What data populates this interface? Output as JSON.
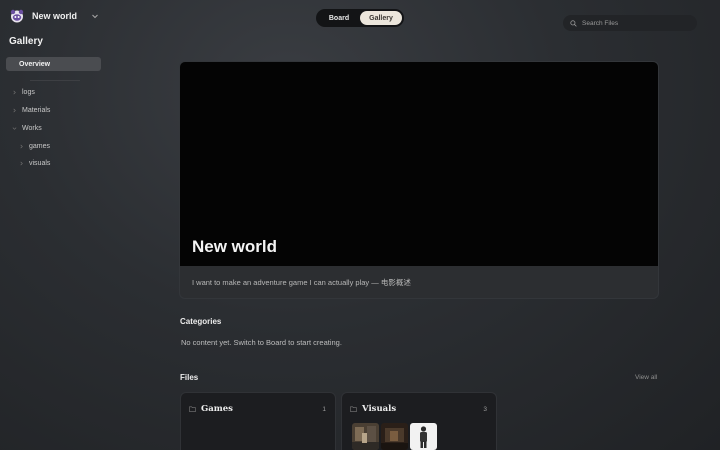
{
  "header": {
    "workspace_name": "New world",
    "view_tabs": [
      {
        "label": "Board",
        "active": false
      },
      {
        "label": "Gallery",
        "active": true
      }
    ],
    "search": {
      "placeholder": "Search Files"
    }
  },
  "sidebar": {
    "title": "Gallery",
    "overview_label": "Overview",
    "tree": [
      {
        "label": "logs",
        "depth": 0
      },
      {
        "label": "Materials",
        "depth": 0
      },
      {
        "label": "Works",
        "depth": 0,
        "expanded": true
      },
      {
        "label": "games",
        "depth": 1
      },
      {
        "label": "visuals",
        "depth": 1
      }
    ]
  },
  "hero": {
    "title": "New world",
    "description": "I want to make an adventure game I can actually play — 电影概述"
  },
  "categories": {
    "heading": "Categories",
    "empty_message": "No content yet. Switch to Board to start creating."
  },
  "files": {
    "heading": "Files",
    "view_all": "View all",
    "folders": [
      {
        "name": "Games",
        "count": "1",
        "thumbnails": []
      },
      {
        "name": "Visuals",
        "count": "3",
        "thumbnails": [
          "interior-scene",
          "dark-scene",
          "figure-standing"
        ]
      }
    ]
  },
  "colors": {
    "background": "#2b2e32",
    "active_tab": "#ece6dc",
    "hero_cover": "#040404",
    "card_bg": "#1c1d20"
  }
}
